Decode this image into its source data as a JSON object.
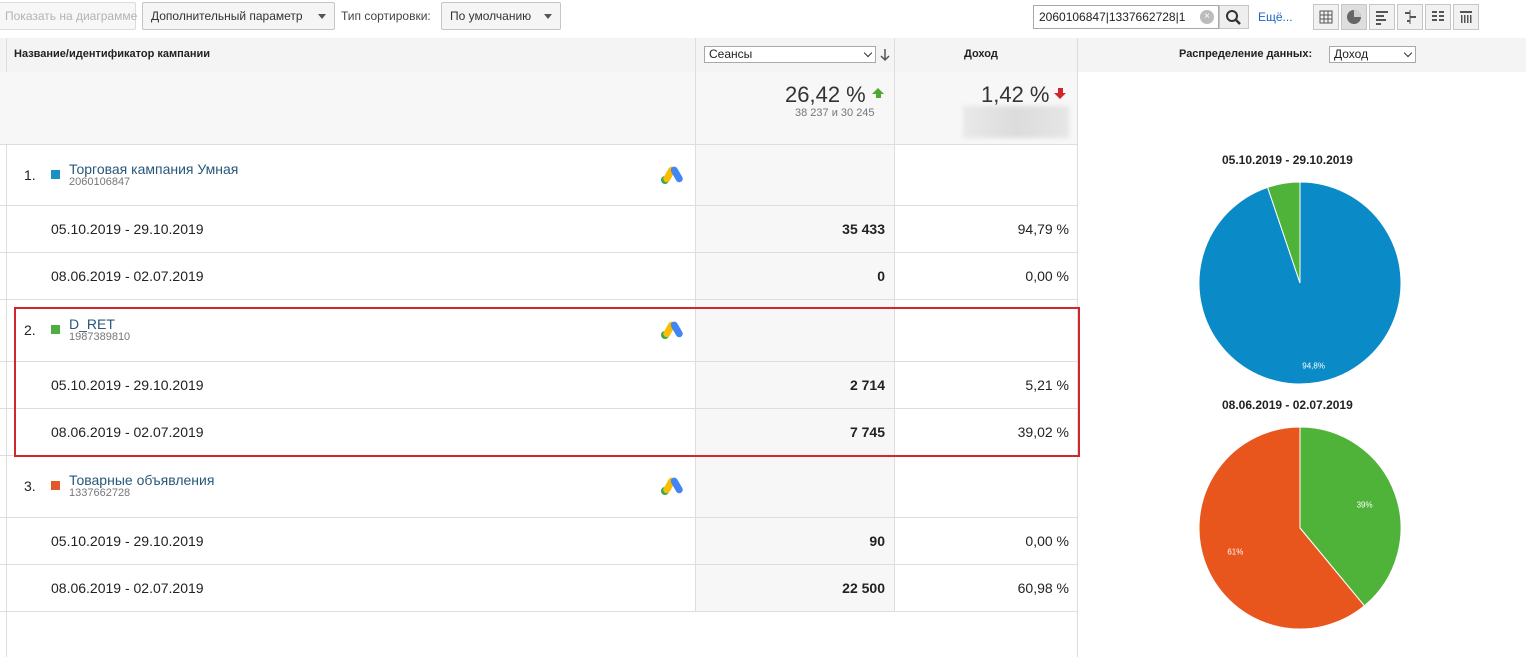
{
  "toolbar": {
    "show_on_chart": "Показать на диаграмме",
    "secondary_dimension": "Дополнительный параметр",
    "sort_type_label": "Тип сортировки:",
    "sort_type_value": "По умолчанию",
    "search_value": "2060106847|1337662728|1",
    "more_link": "Ещё..."
  },
  "header": {
    "campaign_col": "Название/идентификатор кампании",
    "metric_select": "Сеансы",
    "revenue_col": "Доход",
    "distribution_label": "Распределение данных:",
    "distribution_select": "Доход"
  },
  "summary": {
    "sessions_change": "26,42 %",
    "sessions_compare": "38 237 и 30 245",
    "revenue_change": "1,42 %"
  },
  "campaigns": [
    {
      "index": "1.",
      "name": "Торговая кампания Умная",
      "id": "2060106847",
      "color": "#1a8fc4",
      "rows": [
        {
          "period": "05.10.2019 - 29.10.2019",
          "sessions": "35 433",
          "revenue": "94,79 %"
        },
        {
          "period": "08.06.2019 - 02.07.2019",
          "sessions": "0",
          "revenue": "0,00 %"
        }
      ]
    },
    {
      "index": "2.",
      "name": "D_RET",
      "id": "1987389810",
      "color": "#4caf3f",
      "rows": [
        {
          "period": "05.10.2019 - 29.10.2019",
          "sessions": "2 714",
          "revenue": "5,21 %"
        },
        {
          "period": "08.06.2019 - 02.07.2019",
          "sessions": "7 745",
          "revenue": "39,02 %"
        }
      ]
    },
    {
      "index": "3.",
      "name": "Товарные объявления",
      "id": "1337662728",
      "color": "#e0592a",
      "rows": [
        {
          "period": "05.10.2019 - 29.10.2019",
          "sessions": "90",
          "revenue": "0,00 %"
        },
        {
          "period": "08.06.2019 - 02.07.2019",
          "sessions": "22 500",
          "revenue": "60,98 %"
        }
      ]
    }
  ],
  "chart_data": [
    {
      "type": "pie",
      "title": "05.10.2019 - 29.10.2019",
      "slices": [
        {
          "value": 94.8,
          "label": "94,8%",
          "color": "#0a8ac6"
        },
        {
          "value": 5.2,
          "label": "",
          "color": "#4fb33a"
        }
      ]
    },
    {
      "type": "pie",
      "title": "08.06.2019 - 02.07.2019",
      "slices": [
        {
          "value": 39,
          "label": "39%",
          "color": "#4fb33a"
        },
        {
          "value": 61,
          "label": "61%",
          "color": "#e8561e"
        }
      ]
    }
  ]
}
